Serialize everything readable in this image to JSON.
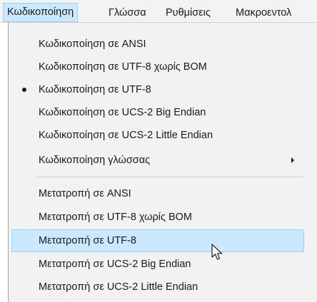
{
  "menubar": {
    "items": [
      {
        "label": "Κωδικοποίηση"
      },
      {
        "label": "Γλώσσα"
      },
      {
        "label": "Ρυθμίσεις"
      },
      {
        "label": "Μακροεντολ"
      }
    ]
  },
  "menu": {
    "items": [
      {
        "label": "Κωδικοποίηση σε ANSI"
      },
      {
        "label": "Κωδικοποίηση σε UTF-8 χωρίς BOM"
      },
      {
        "label": "Κωδικοποίηση σε UTF-8",
        "checked": true
      },
      {
        "label": "Κωδικοποίηση σε UCS-2 Big Endian"
      },
      {
        "label": "Κωδικοποίηση σε UCS-2 Little Endian"
      },
      {
        "label": "Κωδικοποίηση γλώσσας",
        "has_submenu": true
      },
      {
        "label": "Μετατροπή σε ANSI"
      },
      {
        "label": "Μετατροπή σε UTF-8 χωρίς BOM"
      },
      {
        "label": "Μετατροπή σε UTF-8",
        "highlighted": true
      },
      {
        "label": "Μετατροπή σε UCS-2 Big Endian"
      },
      {
        "label": "Μετατροπή σε UCS-2 Little Endian"
      }
    ]
  },
  "icons": {
    "checked_indicator": "radio-dot-icon",
    "submenu_indicator": "chevron-right-icon",
    "pointer": "mouse-cursor-icon"
  },
  "colors": {
    "highlight_fill": "#cce8ff",
    "highlight_border": "#99d1ff",
    "menu_background": "#f2f2f2"
  }
}
